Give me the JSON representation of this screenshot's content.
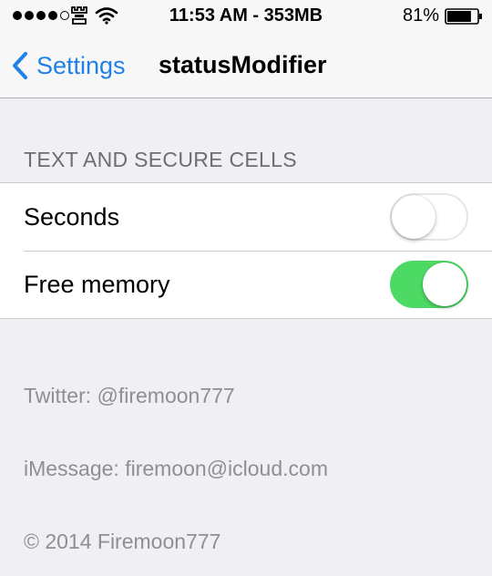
{
  "status_bar": {
    "time_memory": "11:53 AM - 353MB",
    "battery_percent": "81%",
    "signal_bars_filled": 4,
    "signal_bars_total": 5,
    "battery_level": 0.81,
    "icons": [
      "signal-dots-icon",
      "carrier-glyph-icon",
      "wifi-icon",
      "battery-icon"
    ]
  },
  "nav": {
    "back_label": "Settings",
    "title": "statusModifier",
    "accent_color": "#1f80e8"
  },
  "section": {
    "header": "TEXT AND SECURE CELLS",
    "cells": [
      {
        "label": "Seconds",
        "on": false
      },
      {
        "label": "Free memory",
        "on": true
      }
    ]
  },
  "footer": {
    "twitter": "Twitter: @firemoon777",
    "imessage": "iMessage: firemoon@icloud.com",
    "copyright": "© 2014 Firemoon777"
  },
  "colors": {
    "toggle_on": "#4cd964",
    "background": "#efeff4"
  }
}
